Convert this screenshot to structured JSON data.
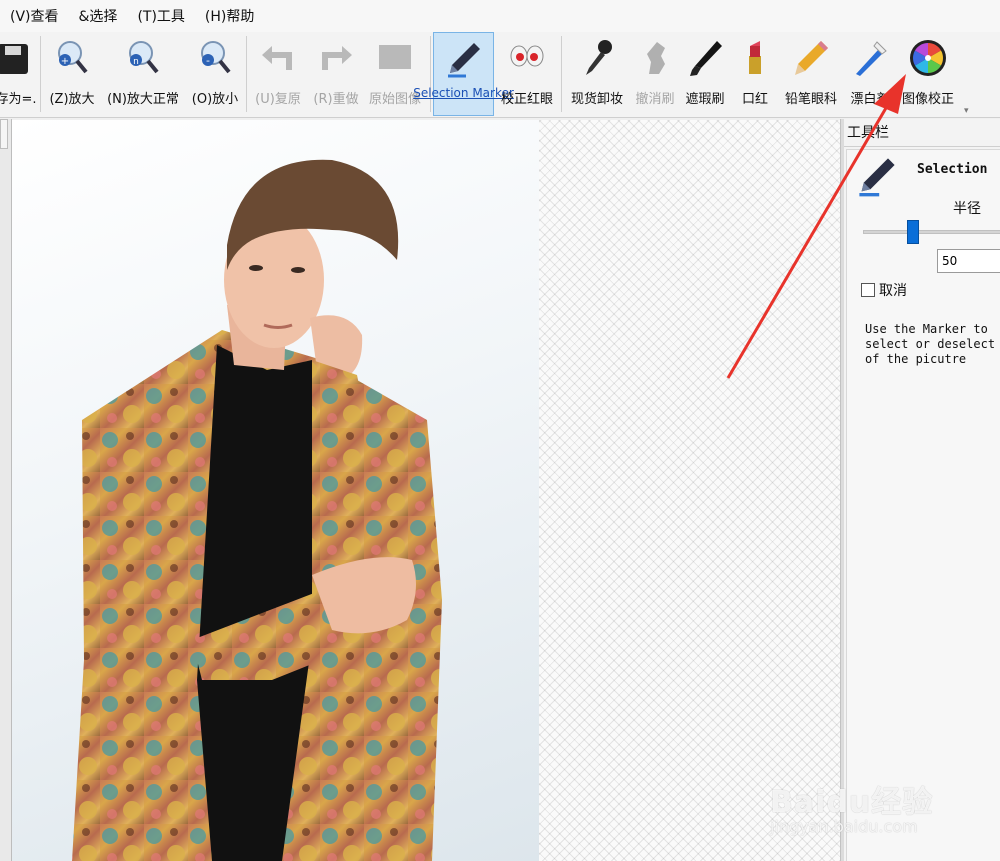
{
  "menu": {
    "items": [
      "(V)查看",
      "&选择",
      "(T)工具",
      "(H)帮助"
    ]
  },
  "toolbar": {
    "save_as": "存为=.",
    "zoom_in": "(Z)放大",
    "zoom_normal": "(N)放大正常",
    "zoom_out": "(O)放小",
    "undo": "(U)复原",
    "redo": "(R)重做",
    "original": "原始图像",
    "selection_marker": "Selection Marker",
    "redeye": "校正红眼",
    "remove_makeup": "现货卸妆",
    "undo_brush": "撤消刷",
    "blemish_brush": "遮瑕刷",
    "lipstick": "口红",
    "eyeliner": "铅笔眼科",
    "whitener": "漂白剂",
    "image_correction": "图像校正"
  },
  "panel": {
    "title": "工具栏",
    "tool_name": "Selection",
    "radius_label": "半径",
    "radius_value": "50",
    "cancel_label": "取消",
    "help_text": "Use the Marker to\nselect or deselect\nof the picutre"
  },
  "slider": {
    "radius_fraction": 0.33
  },
  "watermark": {
    "text": "Baidu经验",
    "url": "jingyan.baidu.com"
  },
  "colors": {
    "accent": "#1a4fb5",
    "arrow": "#e8332b",
    "slider": "#0a6ed8"
  }
}
